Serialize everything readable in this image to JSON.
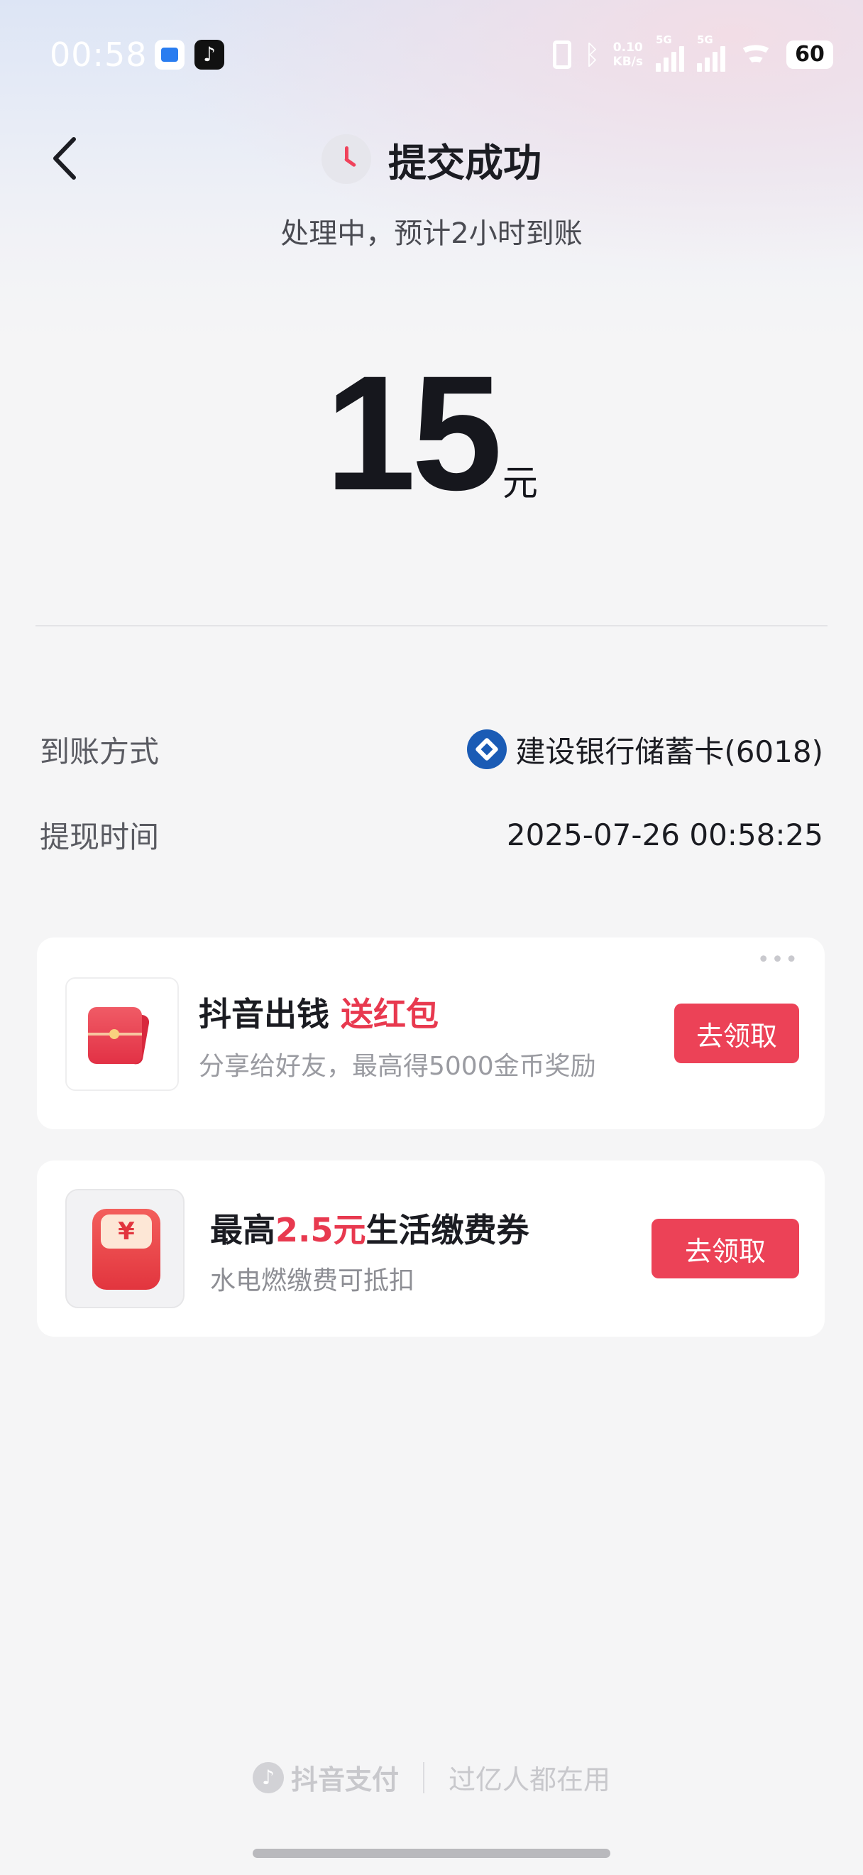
{
  "status_bar": {
    "time": "00:58",
    "net_speed_value": "0.10",
    "net_speed_unit": "KB/s",
    "sim1": "5G",
    "sim2": "5G",
    "battery": "60"
  },
  "header": {
    "title": "提交成功",
    "subtitle": "处理中，预计2小时到账"
  },
  "amount": {
    "value": "15",
    "unit": "元"
  },
  "details": [
    {
      "label": "到账方式",
      "value": "建设银行储蓄卡(6018)"
    },
    {
      "label": "提现时间",
      "value": "2025-07-26 00:58:25"
    }
  ],
  "promo_cards": [
    {
      "title_main": "抖音出钱",
      "title_highlight": "送红包",
      "subtitle": "分享给好友，最高得5000金币奖励",
      "button": "去领取"
    },
    {
      "title_prefix": "最高",
      "title_highlight": "2.5元",
      "title_suffix": "生活缴费券",
      "subtitle": "水电燃缴费可抵扣",
      "button": "去领取",
      "icon_symbol": "¥"
    }
  ],
  "footer": {
    "brand": "抖音支付",
    "slogan": "过亿人都在用"
  },
  "colors": {
    "accent": "#ec4257",
    "bank": "#1a5bb5"
  }
}
